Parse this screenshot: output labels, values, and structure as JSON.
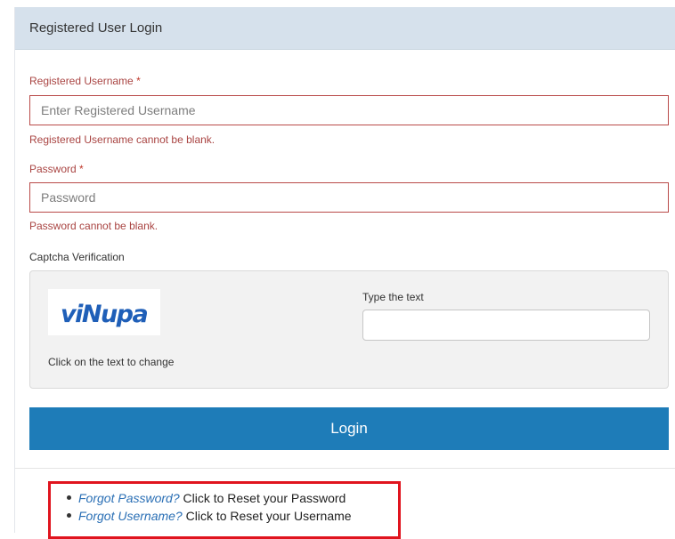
{
  "panel": {
    "title": "Registered User Login"
  },
  "username": {
    "label": "Registered Username",
    "required_mark": "*",
    "placeholder": "Enter Registered Username",
    "value": "",
    "error": "Registered Username cannot be blank."
  },
  "password": {
    "label": "Password",
    "required_mark": "*",
    "placeholder": "Password",
    "value": "",
    "error": "Password cannot be blank."
  },
  "captcha": {
    "section_label": "Captcha Verification",
    "image_text": "viNupa",
    "hint": "Click on the text to change",
    "input_label": "Type the text",
    "input_value": ""
  },
  "login_button": {
    "label": "Login"
  },
  "links": [
    {
      "link_text": "Forgot Password?",
      "suffix": " Click to Reset your Password"
    },
    {
      "link_text": "Forgot Username?",
      "suffix": " Click to Reset your Username"
    }
  ],
  "colors": {
    "header_bg": "#d6e1ec",
    "error_red": "#a94442",
    "login_blue": "#1e7cb8",
    "link_blue": "#2a6fb5",
    "highlight_red": "#e0141e",
    "captcha_blue": "#1f5fb8"
  }
}
